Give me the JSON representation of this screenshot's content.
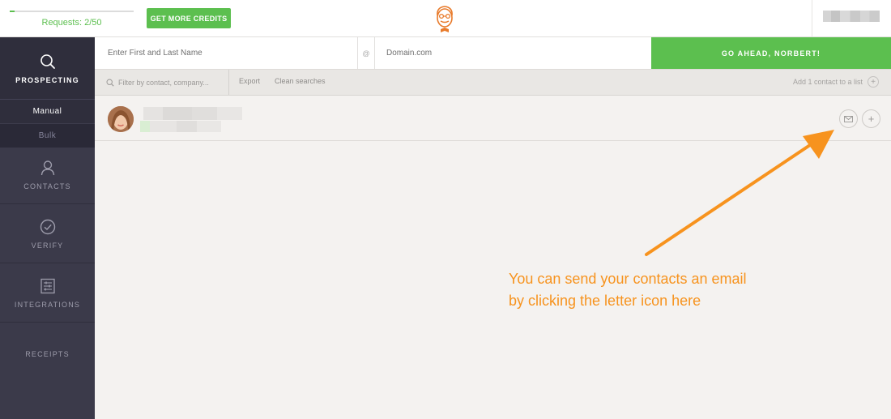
{
  "header": {
    "requests_text": "Requests: 2/50",
    "requests_progress": 0.04,
    "credits_button": "GET MORE CREDITS",
    "logo_icon": "norbert-face-icon"
  },
  "sidebar": {
    "prospecting": {
      "label": "PROSPECTING",
      "icon": "search-icon"
    },
    "sub_items": [
      "Manual",
      "Bulk"
    ],
    "contacts": {
      "label": "CONTACTS",
      "icon": "person-icon"
    },
    "verify": {
      "label": "VERIFY",
      "icon": "check-circle-icon"
    },
    "integrations": {
      "label": "INTEGRATIONS",
      "icon": "sliders-icon"
    },
    "receipts": {
      "label": "RECEIPTS"
    }
  },
  "search": {
    "name_placeholder": "Enter First and Last Name",
    "at_symbol": "@",
    "domain_placeholder": "Domain.com",
    "go_button": "GO AHEAD, NORBERT!"
  },
  "filter": {
    "placeholder": "Filter by contact, company...",
    "export": "Export",
    "clean": "Clean searches",
    "add_to_list": "Add 1 contact to a list",
    "add_symbol": "+"
  },
  "contact_row": {
    "mail_icon": "envelope-icon",
    "add_symbol": "+"
  },
  "annotation": {
    "text": "You can send your contacts an email by clicking the letter icon here"
  },
  "colors": {
    "accent_green": "#5cbf4f",
    "sidebar_bg": "#3b3a4a",
    "annotation_orange": "#f7931e"
  }
}
